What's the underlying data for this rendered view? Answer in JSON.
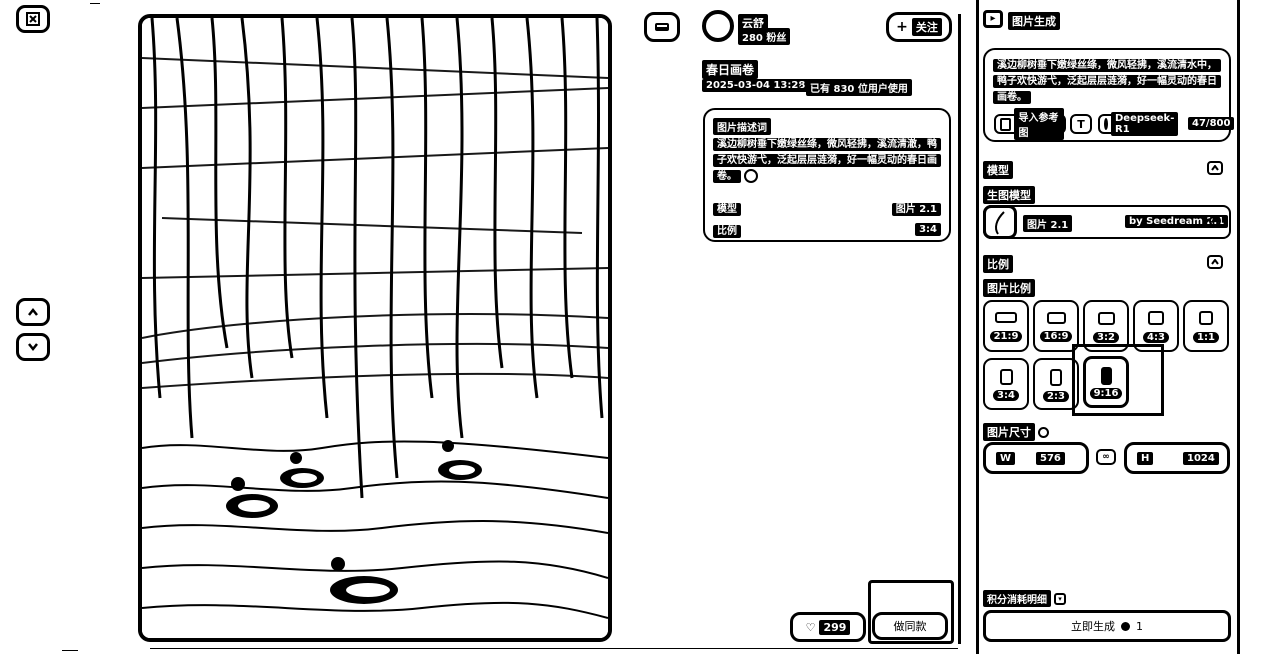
{
  "left_rail": {
    "close_icon": "close-icon",
    "prev_icon": "chevron-up-icon",
    "next_icon": "chevron-down-icon"
  },
  "author": {
    "name": "云舒",
    "followers": "280 粉丝",
    "follow_label": "关注"
  },
  "post": {
    "title": "春日画卷",
    "date": "2025-03-04 13:28",
    "usage": "已有 830 位用户使用"
  },
  "prompt_card": {
    "heading": "图片描述词",
    "text": "溪边柳树垂下嫩绿丝绦，微风轻拂，溪流清澈，鸭子欢快游弋，泛起层层涟漪，好一幅灵动的春日画卷。",
    "model_label": "模型",
    "model_value": "图片 2.1",
    "ratio_label": "比例",
    "ratio_value": "3:4"
  },
  "actions": {
    "likes": "299",
    "same_label": "做同款"
  },
  "panel": {
    "title": "图片生成",
    "prompt_text": "溪边柳树垂下嫩绿丝绦，微风轻拂，溪流清水中，鸭子欢快游弋，泛起层层涟漪，好一幅灵动的春日画卷。",
    "import_ref": "导入参考图",
    "llm": "Deepseek-R1",
    "char_count": "47/800",
    "model_section": "模型",
    "model_sub": "生图模型",
    "model_name": "图片 2.1",
    "model_by": "by Seedream 2.1",
    "ratio_section": "比例",
    "ratio_sub": "图片比例",
    "ratios": [
      "21:9",
      "16:9",
      "3:2",
      "4:3",
      "1:1",
      "3:4",
      "2:3",
      "9:16"
    ],
    "selected_ratio": "9:16",
    "size_label": "图片尺寸",
    "w_label": "W",
    "w_value": "576",
    "h_label": "H",
    "h_value": "1024",
    "cost_label": "积分消耗明细",
    "generate_label": "立即生成",
    "generate_cost": "1"
  }
}
